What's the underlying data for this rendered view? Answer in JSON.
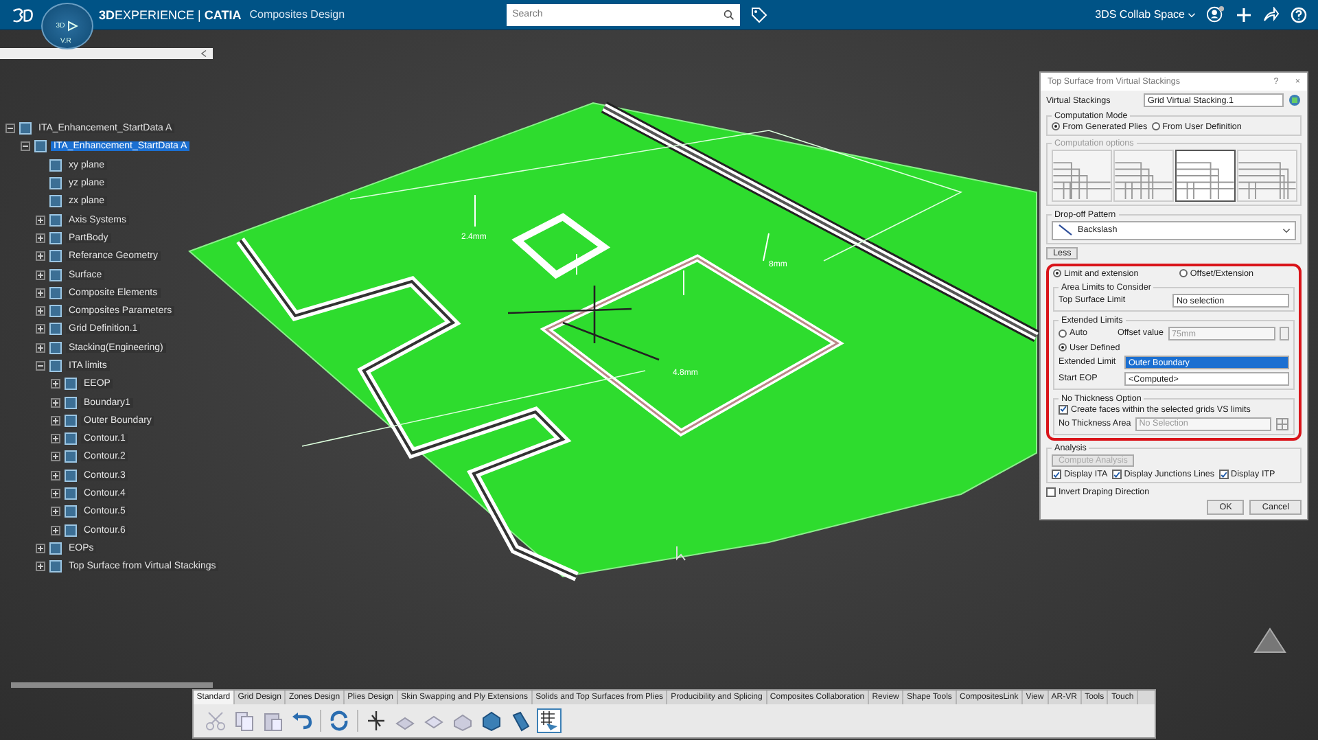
{
  "header": {
    "brand": "**3D**EXPERIENCE | **CATIA**",
    "app": "Composites Design",
    "compass_labels": [
      "3D",
      "V.R"
    ],
    "search": {
      "placeholder": "Search"
    },
    "collab_space": "3DS Collab Space"
  },
  "tree": [
    {
      "label": "ITA_Enhancement_StartData A",
      "expanded": true,
      "selected": false,
      "children": [
        {
          "label": "ITA_Enhancement_StartData A",
          "expanded": true,
          "selected": true,
          "children": [
            {
              "label": "xy plane",
              "selected": false
            },
            {
              "label": "yz plane",
              "selected": false
            },
            {
              "label": "zx plane",
              "selected": false
            },
            {
              "label": "Axis Systems",
              "expanded": false,
              "selected": false
            },
            {
              "label": "PartBody",
              "expanded": false,
              "selected": false
            },
            {
              "label": "Referance Geometry",
              "expanded": false,
              "selected": false
            },
            {
              "label": "Surface",
              "expanded": false,
              "selected": false
            },
            {
              "label": "Composite Elements",
              "expanded": false,
              "selected": false
            },
            {
              "label": "Composites Parameters",
              "expanded": false,
              "selected": false
            },
            {
              "label": "Grid Definition.1",
              "expanded": false,
              "selected": false
            },
            {
              "label": "Stacking(Engineering)",
              "expanded": false,
              "selected": false
            },
            {
              "label": "ITA limits",
              "expanded": true,
              "selected": false,
              "children": [
                {
                  "label": "EEOP",
                  "expanded": false,
                  "selected": false
                },
                {
                  "label": "Boundary1",
                  "expanded": false,
                  "selected": false
                },
                {
                  "label": "Outer Boundary",
                  "expanded": false,
                  "selected": false
                },
                {
                  "label": "Contour.1",
                  "expanded": false,
                  "selected": false
                },
                {
                  "label": "Contour.2",
                  "expanded": false,
                  "selected": false
                },
                {
                  "label": "Contour.3",
                  "expanded": false,
                  "selected": false
                },
                {
                  "label": "Contour.4",
                  "expanded": false,
                  "selected": false
                },
                {
                  "label": "Contour.5",
                  "expanded": false,
                  "selected": false
                },
                {
                  "label": "Contour.6",
                  "expanded": false,
                  "selected": false
                }
              ]
            },
            {
              "label": "EOPs",
              "expanded": false,
              "selected": false
            },
            {
              "label": "Top Surface from Virtual Stackings",
              "expanded": false,
              "selected": false
            }
          ]
        }
      ]
    }
  ],
  "model_labels": [
    "2.4mm",
    "4.8mm",
    "8mm"
  ],
  "dialog": {
    "title": "Top Surface from Virtual Stackings",
    "help": "?",
    "close": "×",
    "virtual_stackings": {
      "label": "Virtual Stackings",
      "value": "Grid Virtual Stacking.1"
    },
    "computation_mode": {
      "label": "Computation Mode",
      "options": [
        {
          "label": "From Generated Plies",
          "selected": true
        },
        {
          "label": "From User Definition",
          "selected": false
        }
      ]
    },
    "computation_options": {
      "label": "Computation options",
      "options": [
        {
          "selected": false
        },
        {
          "selected": false
        },
        {
          "selected": true
        },
        {
          "selected": false
        }
      ]
    },
    "drop_off_pattern": {
      "label": "Drop-off Pattern",
      "value": "Backslash"
    },
    "less_button": "Less",
    "limit_mode": [
      {
        "label": "Limit and extension",
        "selected": true
      },
      {
        "label": "Offset/Extension",
        "selected": false
      }
    ],
    "area_limits": {
      "label": "Area Limits to Consider",
      "field_label": "Top Surface Limit",
      "value": "No selection"
    },
    "extended_limits": {
      "label": "Extended Limits",
      "options": [
        {
          "label": "Auto",
          "selected": false
        },
        {
          "label": "User Defined",
          "selected": true
        }
      ],
      "offset_label": "Offset value",
      "offset_value": "75mm",
      "offset_disabled": true,
      "limit_label": "Extended Limit",
      "limit_value": "Outer Boundary",
      "start_label": "Start EOP",
      "start_value": "<Computed>"
    },
    "no_thickness": {
      "label": "No Thickness Option",
      "checkbox": {
        "label": "Create faces within the selected grids VS limits",
        "checked": true
      },
      "area_label": "No Thickness Area",
      "area_placeholder": "No Selection"
    },
    "analysis": {
      "label": "Analysis",
      "button": "Compute Analysis",
      "button_disabled": true,
      "checkboxes": [
        {
          "label": "Display ITA",
          "checked": true
        },
        {
          "label": "Display Junctions Lines",
          "checked": true
        },
        {
          "label": "Display ITP",
          "checked": true
        }
      ]
    },
    "invert": {
      "label": "Invert Draping Direction",
      "checked": false
    },
    "buttons": [
      "OK",
      "Cancel"
    ]
  },
  "toolbar": {
    "tabs": [
      {
        "label": "Standard",
        "selected": true
      },
      {
        "label": "Grid Design",
        "selected": false
      },
      {
        "label": "Zones Design",
        "selected": false
      },
      {
        "label": "Plies Design",
        "selected": false
      },
      {
        "label": "Skin Swapping and Ply Extensions",
        "selected": false
      },
      {
        "label": "Solids and Top Surfaces from Plies",
        "selected": false
      },
      {
        "label": "Producibility and Splicing",
        "selected": false
      },
      {
        "label": "Composites Collaboration",
        "selected": false
      },
      {
        "label": "Review",
        "selected": false
      },
      {
        "label": "Shape Tools",
        "selected": false
      },
      {
        "label": "CompositesLink",
        "selected": false
      },
      {
        "label": "View",
        "selected": false
      },
      {
        "label": "AR-VR",
        "selected": false
      },
      {
        "label": "Tools",
        "selected": false
      },
      {
        "label": "Touch",
        "selected": false
      }
    ]
  }
}
